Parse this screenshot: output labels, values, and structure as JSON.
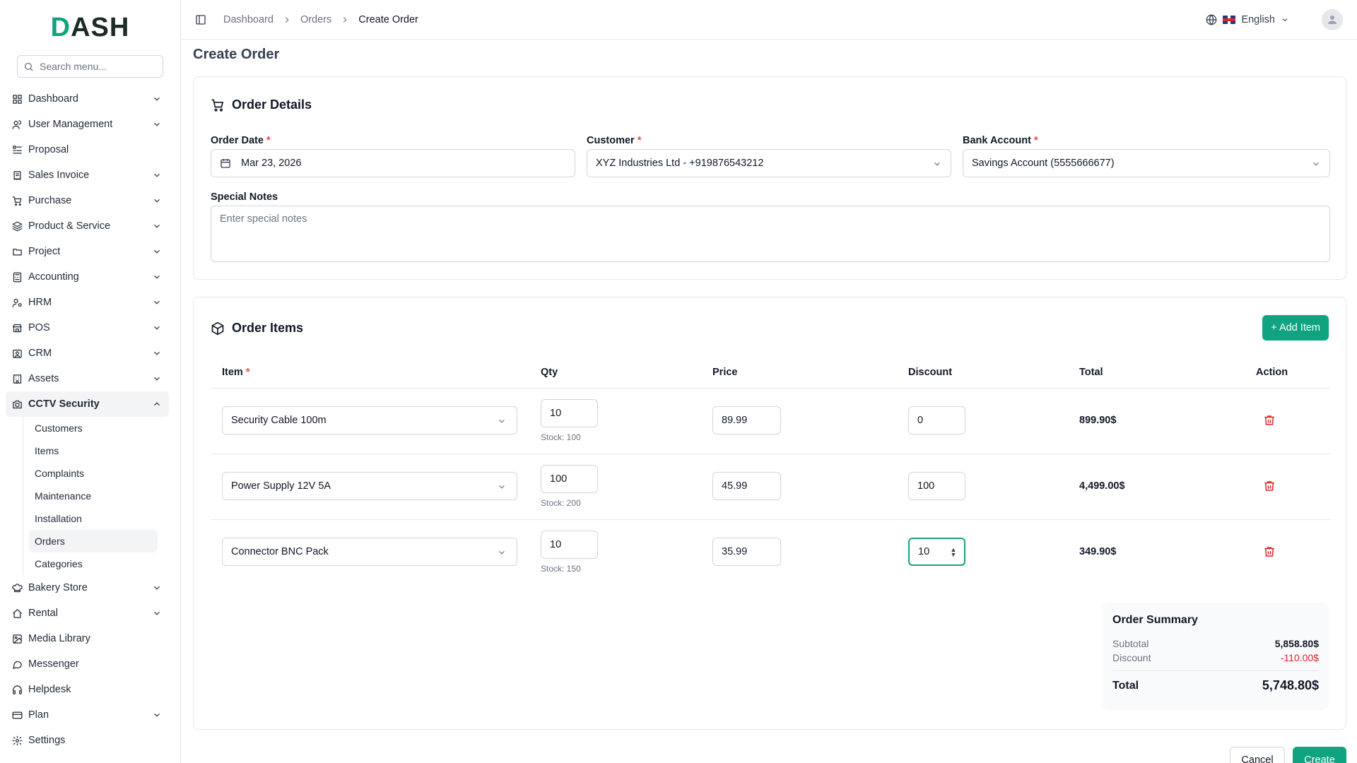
{
  "app": {
    "logo_text": "DASH",
    "search_placeholder": "Search menu..."
  },
  "sidebar": {
    "items": [
      {
        "label": "Dashboard",
        "icon": "grid-icon",
        "has_chevron": true
      },
      {
        "label": "User Management",
        "icon": "users-icon",
        "has_chevron": true
      },
      {
        "label": "Proposal",
        "icon": "proposal-icon",
        "has_chevron": false
      },
      {
        "label": "Sales Invoice",
        "icon": "receipt-icon",
        "has_chevron": true
      },
      {
        "label": "Purchase",
        "icon": "cart-icon",
        "has_chevron": true
      },
      {
        "label": "Product & Service",
        "icon": "layers-icon",
        "has_chevron": true
      },
      {
        "label": "Project",
        "icon": "folder-icon",
        "has_chevron": true
      },
      {
        "label": "Accounting",
        "icon": "calculator-icon",
        "has_chevron": true
      },
      {
        "label": "HRM",
        "icon": "user-cog-icon",
        "has_chevron": true
      },
      {
        "label": "POS",
        "icon": "store-icon",
        "has_chevron": true
      },
      {
        "label": "CRM",
        "icon": "contact-icon",
        "has_chevron": true
      },
      {
        "label": "Assets",
        "icon": "building-icon",
        "has_chevron": true
      },
      {
        "label": "CCTV Security",
        "icon": "camera-icon",
        "has_chevron": true,
        "expanded": true
      }
    ],
    "cctv_sub": [
      {
        "label": "Customers"
      },
      {
        "label": "Items"
      },
      {
        "label": "Complaints"
      },
      {
        "label": "Maintenance"
      },
      {
        "label": "Installation"
      },
      {
        "label": "Orders",
        "active": true
      },
      {
        "label": "Categories"
      }
    ],
    "items_after": [
      {
        "label": "Bakery Store",
        "icon": "chef-icon",
        "has_chevron": true
      },
      {
        "label": "Rental",
        "icon": "home-icon",
        "has_chevron": true
      },
      {
        "label": "Media Library",
        "icon": "image-icon",
        "has_chevron": false
      },
      {
        "label": "Messenger",
        "icon": "message-icon",
        "has_chevron": false
      },
      {
        "label": "Helpdesk",
        "icon": "headphones-icon",
        "has_chevron": false
      },
      {
        "label": "Plan",
        "icon": "credit-card-icon",
        "has_chevron": true
      },
      {
        "label": "Settings",
        "icon": "gear-icon",
        "has_chevron": false
      }
    ]
  },
  "header": {
    "breadcrumbs": [
      "Dashboard",
      "Orders",
      "Create Order"
    ],
    "language": "English"
  },
  "page": {
    "title": "Create Order"
  },
  "order_details": {
    "title": "Order Details",
    "order_date_label": "Order Date",
    "order_date_value": "Mar 23, 2026",
    "customer_label": "Customer",
    "customer_value": "XYZ Industries Ltd - +919876543212",
    "bank_label": "Bank Account",
    "bank_value": "Savings Account (5555666677)",
    "notes_label": "Special Notes",
    "notes_placeholder": "Enter special notes",
    "required_mark": "*"
  },
  "order_items": {
    "title": "Order Items",
    "add_button": "+ Add Item",
    "columns": {
      "item": "Item",
      "qty": "Qty",
      "price": "Price",
      "discount": "Discount",
      "total": "Total",
      "action": "Action"
    },
    "rows": [
      {
        "item": "Security Cable 100m",
        "qty": "10",
        "stock": "Stock: 100",
        "price": "89.99",
        "discount": "0",
        "total": "899.90$"
      },
      {
        "item": "Power Supply 12V 5A",
        "qty": "100",
        "stock": "Stock: 200",
        "price": "45.99",
        "discount": "100",
        "total": "4,499.00$"
      },
      {
        "item": "Connector BNC Pack",
        "qty": "10",
        "stock": "Stock: 150",
        "price": "35.99",
        "discount": "10",
        "total": "349.90$"
      }
    ]
  },
  "summary": {
    "title": "Order Summary",
    "subtotal_label": "Subtotal",
    "subtotal_value": "5,858.80$",
    "discount_label": "Discount",
    "discount_value": "-110.00$",
    "total_label": "Total",
    "total_value": "5,748.80$"
  },
  "actions": {
    "cancel": "Cancel",
    "create": "Create"
  },
  "colors": {
    "accent": "#10a37f",
    "danger": "#dc2626"
  }
}
